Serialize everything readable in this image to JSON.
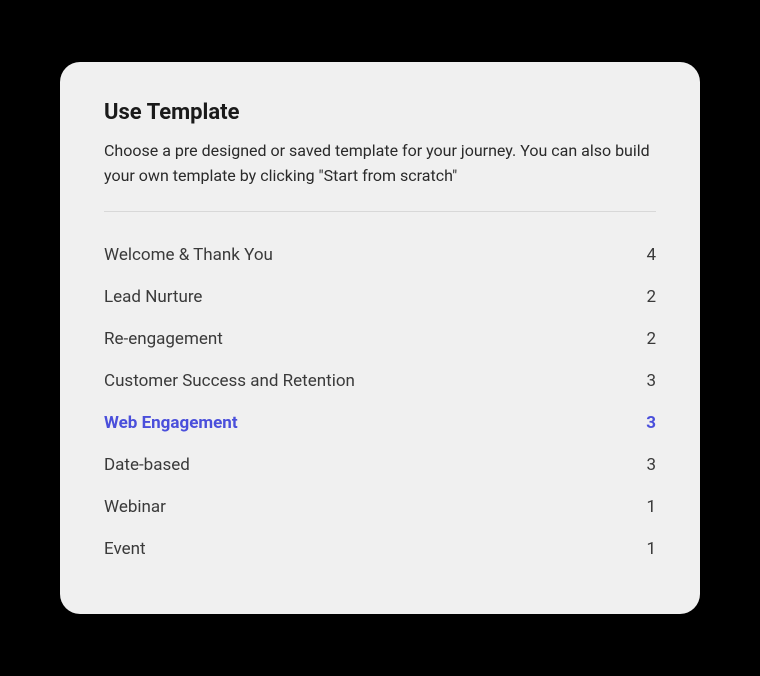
{
  "modal": {
    "title": "Use Template",
    "description": "Choose a pre designed or saved template for your journey. You can also build your own template by clicking \"Start from scratch\""
  },
  "templates": [
    {
      "label": "Welcome & Thank You",
      "count": "4",
      "active": false
    },
    {
      "label": "Lead Nurture",
      "count": "2",
      "active": false
    },
    {
      "label": "Re-engagement",
      "count": "2",
      "active": false
    },
    {
      "label": "Customer Success and Retention",
      "count": "3",
      "active": false
    },
    {
      "label": "Web Engagement",
      "count": "3",
      "active": true
    },
    {
      "label": "Date-based",
      "count": "3",
      "active": false
    },
    {
      "label": "Webinar",
      "count": "1",
      "active": false
    },
    {
      "label": "Event",
      "count": "1",
      "active": false
    }
  ]
}
